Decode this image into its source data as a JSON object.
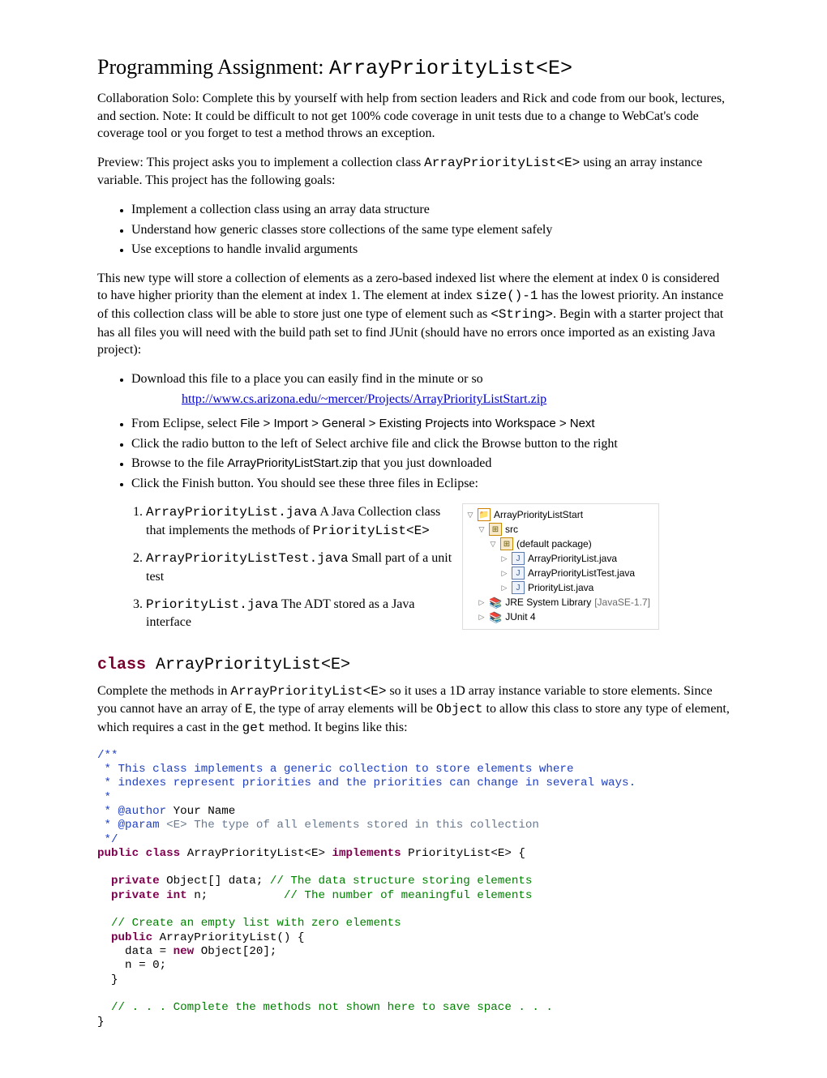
{
  "title": {
    "prefix": "Programming Assignment: ",
    "mono": "ArrayPriorityList<E>"
  },
  "p_collab": "Collaboration Solo: Complete this by yourself with help from section leaders and Rick and code from our book, lectures, and section. Note: It could be difficult to not get 100% code coverage in unit tests due to a change to WebCat's code coverage tool or you forget to test a method throws an exception.",
  "p_preview_a": "Preview: This project asks you to implement a collection class ",
  "p_preview_mono": "ArrayPriorityList<E>",
  "p_preview_b": " using an array instance variable. This project has the following goals:",
  "goals": [
    "Implement a collection class using an array data structure",
    "Understand how generic classes store collections of the same type element safely",
    "Use exceptions to handle invalid arguments"
  ],
  "p_zero_a": "This new type will store a collection of elements as a zero-based indexed list where the element at index 0 is considered to have higher priority than the element at index 1. The element at index ",
  "p_zero_mono1": "size()-1",
  "p_zero_b": " has the lowest priority. An instance of this collection class will be able to store just one type of element such as ",
  "p_zero_mono2": " <String>",
  "p_zero_c": ". Begin with a starter project that has all files you will need with the build path set to find JUnit (should have no errors once imported as an existing Java project):",
  "steps": {
    "download": "Download this file to a place you can easily find in the minute or so",
    "url": "http://www.cs.arizona.edu/~mercer/Projects/ArrayPriorityListStart.zip",
    "eclipse_a": "From Eclipse, select ",
    "eclipse_b": "File > Import > General > Existing Projects into Workspace > Next",
    "radio": "Click the radio button to the left of Select archive file and click the Browse button to the right",
    "browse_a": "Browse to the file ",
    "browse_b": "ArrayPriorityListStart.zip",
    "browse_c": " that you just downloaded",
    "finish": "Click the Finish button. You should see these three files in Eclipse:"
  },
  "files": {
    "f1_code": "ArrayPriorityList.java",
    "f1_txt_a": "  A Java Collection class that implements the methods of ",
    "f1_txt_b": "PriorityList<E>",
    "f2_code": "ArrayPriorityListTest.java",
    "f2_txt": " Small part of a unit test",
    "f3_code": "PriorityList.java",
    "f3_txt": " The ADT stored as a Java interface"
  },
  "tree": {
    "proj": "ArrayPriorityListStart",
    "src": "src",
    "pkg": "(default package)",
    "j1": "ArrayPriorityList.java",
    "j2": "ArrayPriorityListTest.java",
    "j3": "PriorityList.java",
    "jre": "JRE System Library ",
    "jrever": "[JavaSE-1.7]",
    "junit": "JUnit 4"
  },
  "hdr_kw": "class",
  "hdr_rest": " ArrayPriorityList<E>",
  "p_complete_a": "Complete  the methods in ",
  "p_complete_mono1": "ArrayPriorityList<E>",
  "p_complete_b": " so it uses a 1D array instance variable to store elements. Since you cannot have an array of ",
  "p_complete_mono2": "E",
  "p_complete_c": ", the type of array elements will be ",
  "p_complete_mono3": "Object",
  "p_complete_d": " to allow this class to store any type of element, which requires a cast in the ",
  "p_complete_mono4": "get",
  "p_complete_e": " method. It begins like this:",
  "code": {
    "jd_open": "/**",
    "jd_l1": " * This class implements a generic collection to store elements where",
    "jd_l2": " * indexes represent priorities and the priorities can change in several ways.",
    "jd_blank": " *",
    "jd_at": " * @author",
    "jd_name": " Your Name",
    "jd_param": " * @param",
    "jd_param_txt": " <E> The type of all elements stored in this collection",
    "jd_close": " */",
    "pub": "public",
    "cls": " class",
    "clsname": " ArrayPriorityList<E> ",
    "impl": "implements",
    "implname": " PriorityList<E> {",
    "priv1a": "  private",
    "priv1b": " Object[] data; ",
    "priv1c": "// The data structure storing elements",
    "priv2a": "  private int",
    "priv2b": " n;           ",
    "priv2c": "// The number of meaningful elements",
    "ctor_c": "  // Create an empty list with zero elements",
    "ctor_a": "  public",
    "ctor_b": " ArrayPriorityList() {",
    "ctor_l1": "    data = ",
    "ctor_new": "new",
    "ctor_l1b": " Object[20];",
    "ctor_l2": "    n = 0;",
    "ctor_l3": "  }",
    "end_c": "  // . . . Complete the methods not shown here to save space . . .",
    "end": "}"
  }
}
